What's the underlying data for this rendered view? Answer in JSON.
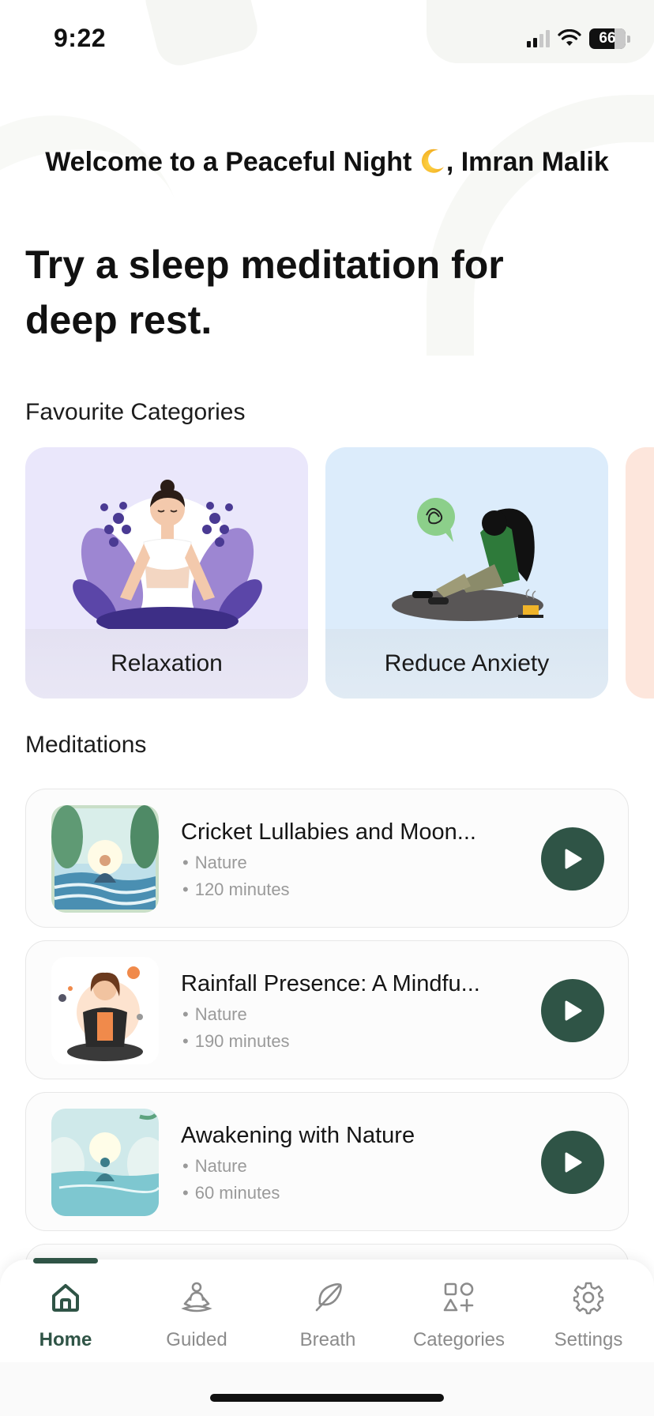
{
  "status_bar": {
    "time": "9:22",
    "battery": "66"
  },
  "header": {
    "welcome_prefix": "Welcome to a Peaceful Night",
    "welcome_suffix": ", Imran Malik",
    "headline": "Try a sleep meditation for deep rest."
  },
  "categories": {
    "title": "Favourite Categories",
    "items": [
      {
        "label": "Relaxation",
        "bg": "#eae7fb"
      },
      {
        "label": "Reduce Anxiety",
        "bg": "#dcecfb"
      }
    ]
  },
  "meditations": {
    "title": "Meditations",
    "items": [
      {
        "title": "Cricket Lullabies and Moon...",
        "category": "Nature",
        "duration": "120 minutes"
      },
      {
        "title": "Rainfall Presence: A Mindfu...",
        "category": "Nature",
        "duration": "190 minutes"
      },
      {
        "title": "Awakening with Nature",
        "category": "Nature",
        "duration": "60 minutes"
      }
    ]
  },
  "tab_bar": {
    "active": "Home",
    "tabs": [
      {
        "label": "Home",
        "icon": "home-icon"
      },
      {
        "label": "Guided",
        "icon": "meditation-person-icon"
      },
      {
        "label": "Breath",
        "icon": "feather-icon"
      },
      {
        "label": "Categories",
        "icon": "shapes-icon"
      },
      {
        "label": "Settings",
        "icon": "gear-icon"
      }
    ]
  },
  "colors": {
    "accent": "#2f5446",
    "muted_text": "#9a9a9a",
    "card_border": "#e7e7e7"
  }
}
